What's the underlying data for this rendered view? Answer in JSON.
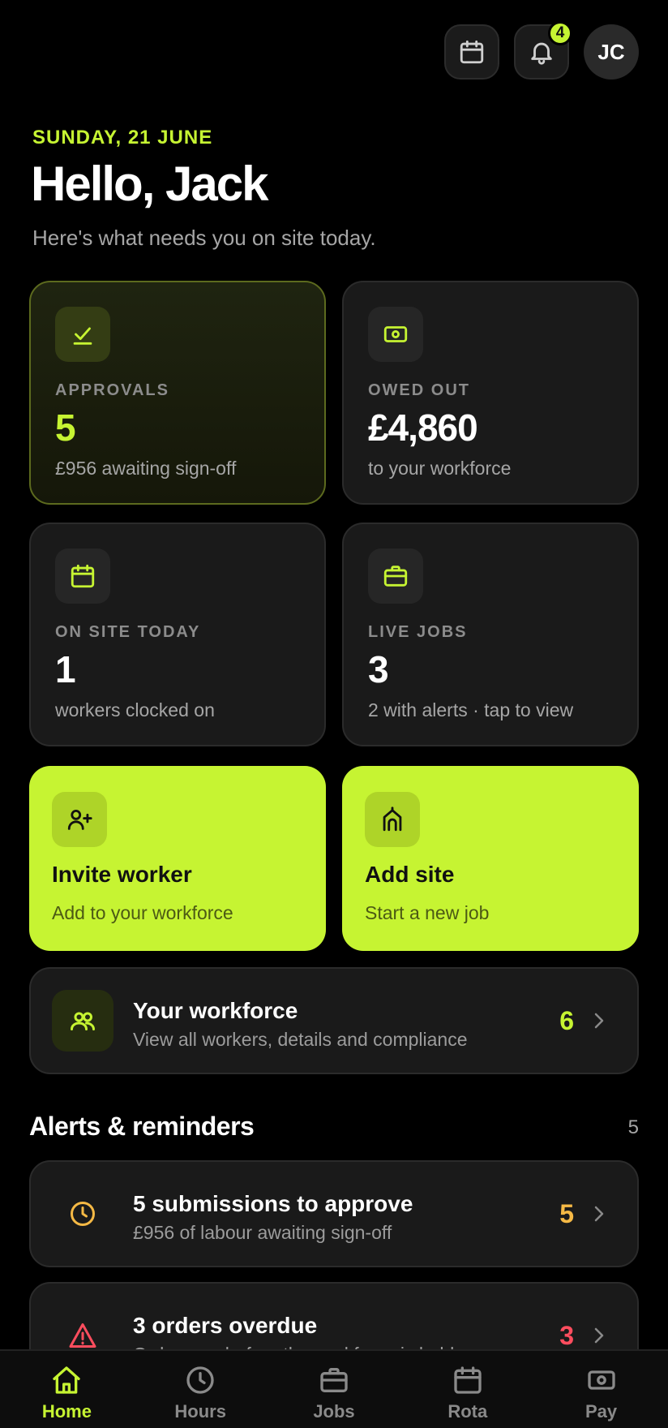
{
  "header": {
    "notification_count": "4",
    "avatar_initials": "JC"
  },
  "greeting": {
    "date": "SUNDAY, 21 JUNE",
    "title": "Hello, Jack",
    "subtitle": "Here's what needs you on site today."
  },
  "stats": [
    {
      "label": "APPROVALS",
      "value": "5",
      "caption": "£956 awaiting sign-off",
      "icon": "check-icon"
    },
    {
      "label": "OWED OUT",
      "value": "£4,860",
      "caption": "to your workforce",
      "icon": "cash-icon"
    },
    {
      "label": "ON SITE TODAY",
      "value": "1",
      "caption": "workers clocked on",
      "icon": "calendar-icon"
    },
    {
      "label": "LIVE JOBS",
      "value": "3",
      "caption": "2 with alerts · tap to view",
      "icon": "briefcase-icon"
    }
  ],
  "actions": [
    {
      "title": "Invite worker",
      "subtitle": "Add to your workforce",
      "icon": "user-plus-icon"
    },
    {
      "title": "Add site",
      "subtitle": "Start a new job",
      "icon": "building-icon"
    }
  ],
  "workforce": {
    "title": "Your workforce",
    "subtitle": "View all workers, details and compliance",
    "count": "6"
  },
  "alerts": {
    "title": "Alerts & reminders",
    "count": "5",
    "items": [
      {
        "title": "5 submissions to approve",
        "subtitle": "£956 of labour awaiting sign-off",
        "count": "5",
        "icon": "clock-icon"
      },
      {
        "title": "3 orders overdue",
        "subtitle": "Order now before the workforce is held up",
        "count": "3",
        "icon": "warning-icon"
      }
    ]
  },
  "colors": {
    "accent": "#c6f432",
    "warning": "#f5b945",
    "danger": "#ff4d5e",
    "background": "#000000",
    "card": "#1a1a1a"
  },
  "tabs": [
    {
      "label": "Home",
      "icon": "home-icon",
      "active": true
    },
    {
      "label": "Hours",
      "icon": "clock-icon",
      "active": false
    },
    {
      "label": "Jobs",
      "icon": "briefcase-icon",
      "active": false
    },
    {
      "label": "Rota",
      "icon": "calendar-icon",
      "active": false
    },
    {
      "label": "Pay",
      "icon": "cash-icon",
      "active": false
    }
  ]
}
